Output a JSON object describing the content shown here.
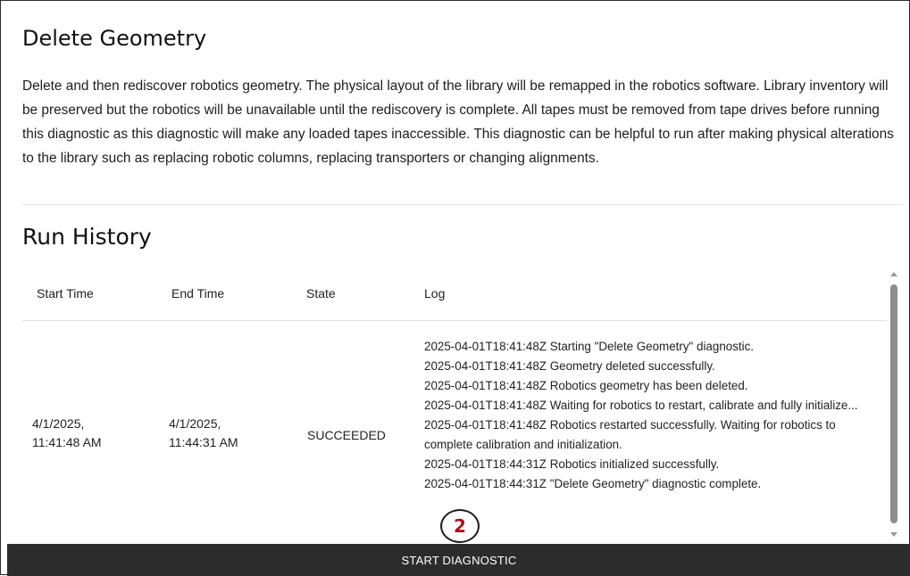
{
  "page": {
    "title": "Delete Geometry",
    "description": "Delete and then rediscover robotics geometry. The physical layout of the library will be remapped in the robotics software. Library inventory will be preserved but the robotics will be unavailable until the rediscovery is complete. All tapes must be removed from tape drives before running this diagnostic as this diagnostic will make any loaded tapes inaccessible. This diagnostic can be helpful to run after making physical alterations to the library such as replacing robotic columns, replacing transporters or changing alignments."
  },
  "run_history": {
    "title": "Run History",
    "columns": {
      "start_time": "Start Time",
      "end_time": "End Time",
      "state": "State",
      "log": "Log"
    },
    "rows": [
      {
        "start_time_line1": "4/1/2025,",
        "start_time_line2": "11:41:48 AM",
        "end_time_line1": "4/1/2025,",
        "end_time_line2": "11:44:31 AM",
        "state": "SUCCEEDED",
        "log": [
          "2025-04-01T18:41:48Z Starting \"Delete Geometry\" diagnostic.",
          "2025-04-01T18:41:48Z Geometry deleted successfully.",
          "2025-04-01T18:41:48Z Robotics geometry has been deleted.",
          "2025-04-01T18:41:48Z Waiting for robotics to restart, calibrate and fully initialize...",
          "2025-04-01T18:41:48Z Robotics restarted successfully. Waiting for robotics to complete calibration and initialization.",
          "2025-04-01T18:44:31Z Robotics initialized successfully.",
          "2025-04-01T18:44:31Z \"Delete Geometry\" diagnostic complete."
        ]
      }
    ]
  },
  "actions": {
    "start_diagnostic": "START DIAGNOSTIC"
  },
  "annotation": {
    "step_number": "2",
    "color": "#b0121b"
  },
  "icons": {
    "scroll_up": "chevron-up-icon",
    "scroll_down": "chevron-down-icon"
  }
}
